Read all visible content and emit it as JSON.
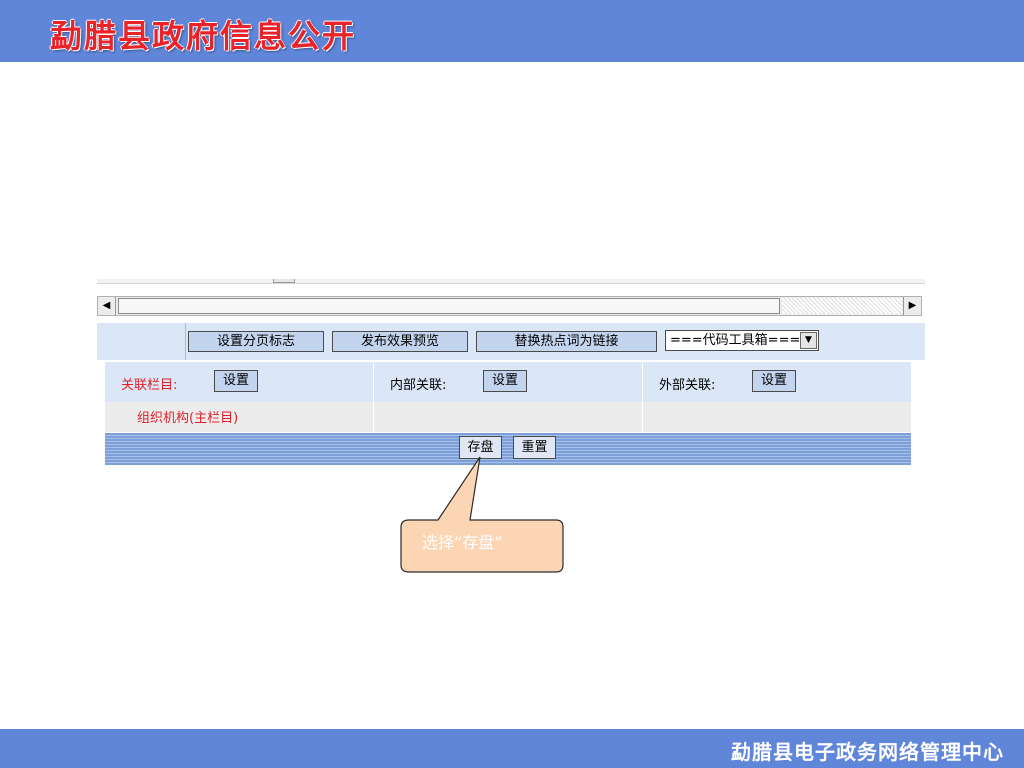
{
  "header": {
    "title": "勐腊县政府信息公开"
  },
  "footer": {
    "text": "勐腊县电子政务网络管理中心"
  },
  "toolbar": {
    "buttons": [
      "设置分页标志",
      "发布效果预览",
      "替换热点词为链接"
    ],
    "select_value": "===代码工具箱==="
  },
  "form": {
    "related_column_label": "关联栏目:",
    "internal_label": "内部关联:",
    "external_label": "外部关联:",
    "settings_button": "设置",
    "column_value": "组织机构(主栏目)"
  },
  "actions": {
    "save": "存盘",
    "reset": "重置"
  },
  "callout": {
    "text": "选择“存盘”"
  },
  "colors": {
    "band": "#5f86d9",
    "title_red": "#e8232a",
    "callout_fill": "#fcd5b4"
  }
}
